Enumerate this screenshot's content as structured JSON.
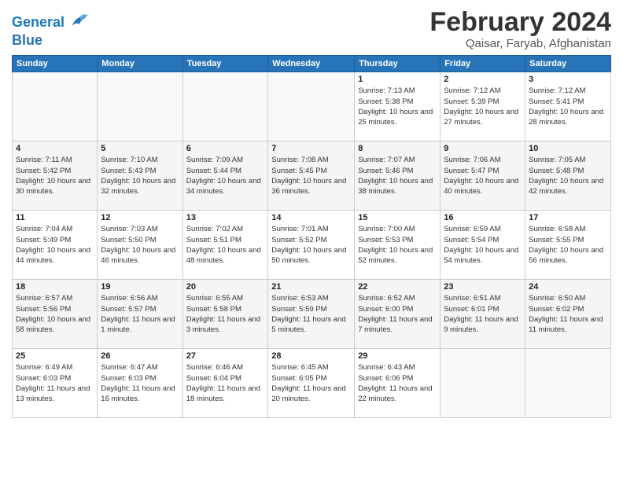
{
  "header": {
    "logo_line1": "General",
    "logo_line2": "Blue",
    "title": "February 2024",
    "subtitle": "Qaisar, Faryab, Afghanistan"
  },
  "weekdays": [
    "Sunday",
    "Monday",
    "Tuesday",
    "Wednesday",
    "Thursday",
    "Friday",
    "Saturday"
  ],
  "weeks": [
    [
      {
        "day": "",
        "sunrise": "",
        "sunset": "",
        "daylight": ""
      },
      {
        "day": "",
        "sunrise": "",
        "sunset": "",
        "daylight": ""
      },
      {
        "day": "",
        "sunrise": "",
        "sunset": "",
        "daylight": ""
      },
      {
        "day": "",
        "sunrise": "",
        "sunset": "",
        "daylight": ""
      },
      {
        "day": "1",
        "sunrise": "Sunrise: 7:13 AM",
        "sunset": "Sunset: 5:38 PM",
        "daylight": "Daylight: 10 hours and 25 minutes."
      },
      {
        "day": "2",
        "sunrise": "Sunrise: 7:12 AM",
        "sunset": "Sunset: 5:39 PM",
        "daylight": "Daylight: 10 hours and 27 minutes."
      },
      {
        "day": "3",
        "sunrise": "Sunrise: 7:12 AM",
        "sunset": "Sunset: 5:41 PM",
        "daylight": "Daylight: 10 hours and 28 minutes."
      }
    ],
    [
      {
        "day": "4",
        "sunrise": "Sunrise: 7:11 AM",
        "sunset": "Sunset: 5:42 PM",
        "daylight": "Daylight: 10 hours and 30 minutes."
      },
      {
        "day": "5",
        "sunrise": "Sunrise: 7:10 AM",
        "sunset": "Sunset: 5:43 PM",
        "daylight": "Daylight: 10 hours and 32 minutes."
      },
      {
        "day": "6",
        "sunrise": "Sunrise: 7:09 AM",
        "sunset": "Sunset: 5:44 PM",
        "daylight": "Daylight: 10 hours and 34 minutes."
      },
      {
        "day": "7",
        "sunrise": "Sunrise: 7:08 AM",
        "sunset": "Sunset: 5:45 PM",
        "daylight": "Daylight: 10 hours and 36 minutes."
      },
      {
        "day": "8",
        "sunrise": "Sunrise: 7:07 AM",
        "sunset": "Sunset: 5:46 PM",
        "daylight": "Daylight: 10 hours and 38 minutes."
      },
      {
        "day": "9",
        "sunrise": "Sunrise: 7:06 AM",
        "sunset": "Sunset: 5:47 PM",
        "daylight": "Daylight: 10 hours and 40 minutes."
      },
      {
        "day": "10",
        "sunrise": "Sunrise: 7:05 AM",
        "sunset": "Sunset: 5:48 PM",
        "daylight": "Daylight: 10 hours and 42 minutes."
      }
    ],
    [
      {
        "day": "11",
        "sunrise": "Sunrise: 7:04 AM",
        "sunset": "Sunset: 5:49 PM",
        "daylight": "Daylight: 10 hours and 44 minutes."
      },
      {
        "day": "12",
        "sunrise": "Sunrise: 7:03 AM",
        "sunset": "Sunset: 5:50 PM",
        "daylight": "Daylight: 10 hours and 46 minutes."
      },
      {
        "day": "13",
        "sunrise": "Sunrise: 7:02 AM",
        "sunset": "Sunset: 5:51 PM",
        "daylight": "Daylight: 10 hours and 48 minutes."
      },
      {
        "day": "14",
        "sunrise": "Sunrise: 7:01 AM",
        "sunset": "Sunset: 5:52 PM",
        "daylight": "Daylight: 10 hours and 50 minutes."
      },
      {
        "day": "15",
        "sunrise": "Sunrise: 7:00 AM",
        "sunset": "Sunset: 5:53 PM",
        "daylight": "Daylight: 10 hours and 52 minutes."
      },
      {
        "day": "16",
        "sunrise": "Sunrise: 6:59 AM",
        "sunset": "Sunset: 5:54 PM",
        "daylight": "Daylight: 10 hours and 54 minutes."
      },
      {
        "day": "17",
        "sunrise": "Sunrise: 6:58 AM",
        "sunset": "Sunset: 5:55 PM",
        "daylight": "Daylight: 10 hours and 56 minutes."
      }
    ],
    [
      {
        "day": "18",
        "sunrise": "Sunrise: 6:57 AM",
        "sunset": "Sunset: 5:56 PM",
        "daylight": "Daylight: 10 hours and 58 minutes."
      },
      {
        "day": "19",
        "sunrise": "Sunrise: 6:56 AM",
        "sunset": "Sunset: 5:57 PM",
        "daylight": "Daylight: 11 hours and 1 minute."
      },
      {
        "day": "20",
        "sunrise": "Sunrise: 6:55 AM",
        "sunset": "Sunset: 5:58 PM",
        "daylight": "Daylight: 11 hours and 3 minutes."
      },
      {
        "day": "21",
        "sunrise": "Sunrise: 6:53 AM",
        "sunset": "Sunset: 5:59 PM",
        "daylight": "Daylight: 11 hours and 5 minutes."
      },
      {
        "day": "22",
        "sunrise": "Sunrise: 6:52 AM",
        "sunset": "Sunset: 6:00 PM",
        "daylight": "Daylight: 11 hours and 7 minutes."
      },
      {
        "day": "23",
        "sunrise": "Sunrise: 6:51 AM",
        "sunset": "Sunset: 6:01 PM",
        "daylight": "Daylight: 11 hours and 9 minutes."
      },
      {
        "day": "24",
        "sunrise": "Sunrise: 6:50 AM",
        "sunset": "Sunset: 6:02 PM",
        "daylight": "Daylight: 11 hours and 11 minutes."
      }
    ],
    [
      {
        "day": "25",
        "sunrise": "Sunrise: 6:49 AM",
        "sunset": "Sunset: 6:03 PM",
        "daylight": "Daylight: 11 hours and 13 minutes."
      },
      {
        "day": "26",
        "sunrise": "Sunrise: 6:47 AM",
        "sunset": "Sunset: 6:03 PM",
        "daylight": "Daylight: 11 hours and 16 minutes."
      },
      {
        "day": "27",
        "sunrise": "Sunrise: 6:46 AM",
        "sunset": "Sunset: 6:04 PM",
        "daylight": "Daylight: 11 hours and 18 minutes."
      },
      {
        "day": "28",
        "sunrise": "Sunrise: 6:45 AM",
        "sunset": "Sunset: 6:05 PM",
        "daylight": "Daylight: 11 hours and 20 minutes."
      },
      {
        "day": "29",
        "sunrise": "Sunrise: 6:43 AM",
        "sunset": "Sunset: 6:06 PM",
        "daylight": "Daylight: 11 hours and 22 minutes."
      },
      {
        "day": "",
        "sunrise": "",
        "sunset": "",
        "daylight": ""
      },
      {
        "day": "",
        "sunrise": "",
        "sunset": "",
        "daylight": ""
      }
    ]
  ]
}
